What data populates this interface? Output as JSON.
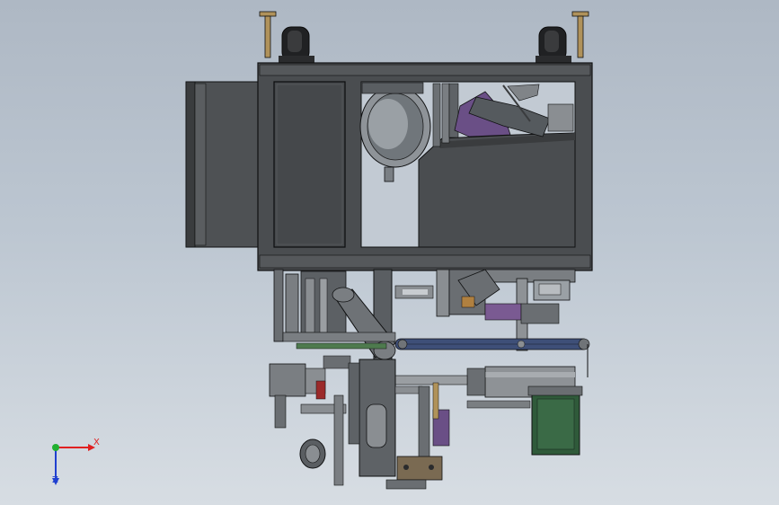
{
  "view": {
    "background_top": "#aeb8c4",
    "background_bottom": "#d7dde3"
  },
  "colors": {
    "frame": "#4a4d50",
    "frame_dark": "#2e3032",
    "edge": "#101112",
    "accent_purple": "#6a4f86",
    "accent_blue": "#3e4f78",
    "motor_green": "#2f5a3a",
    "brass": "#b0925a",
    "caster": "#202123"
  },
  "triad": {
    "x_label": "X",
    "z_label": "Z",
    "x_color": "#e02020",
    "y_color": "#20b030",
    "z_color": "#2040d0"
  }
}
